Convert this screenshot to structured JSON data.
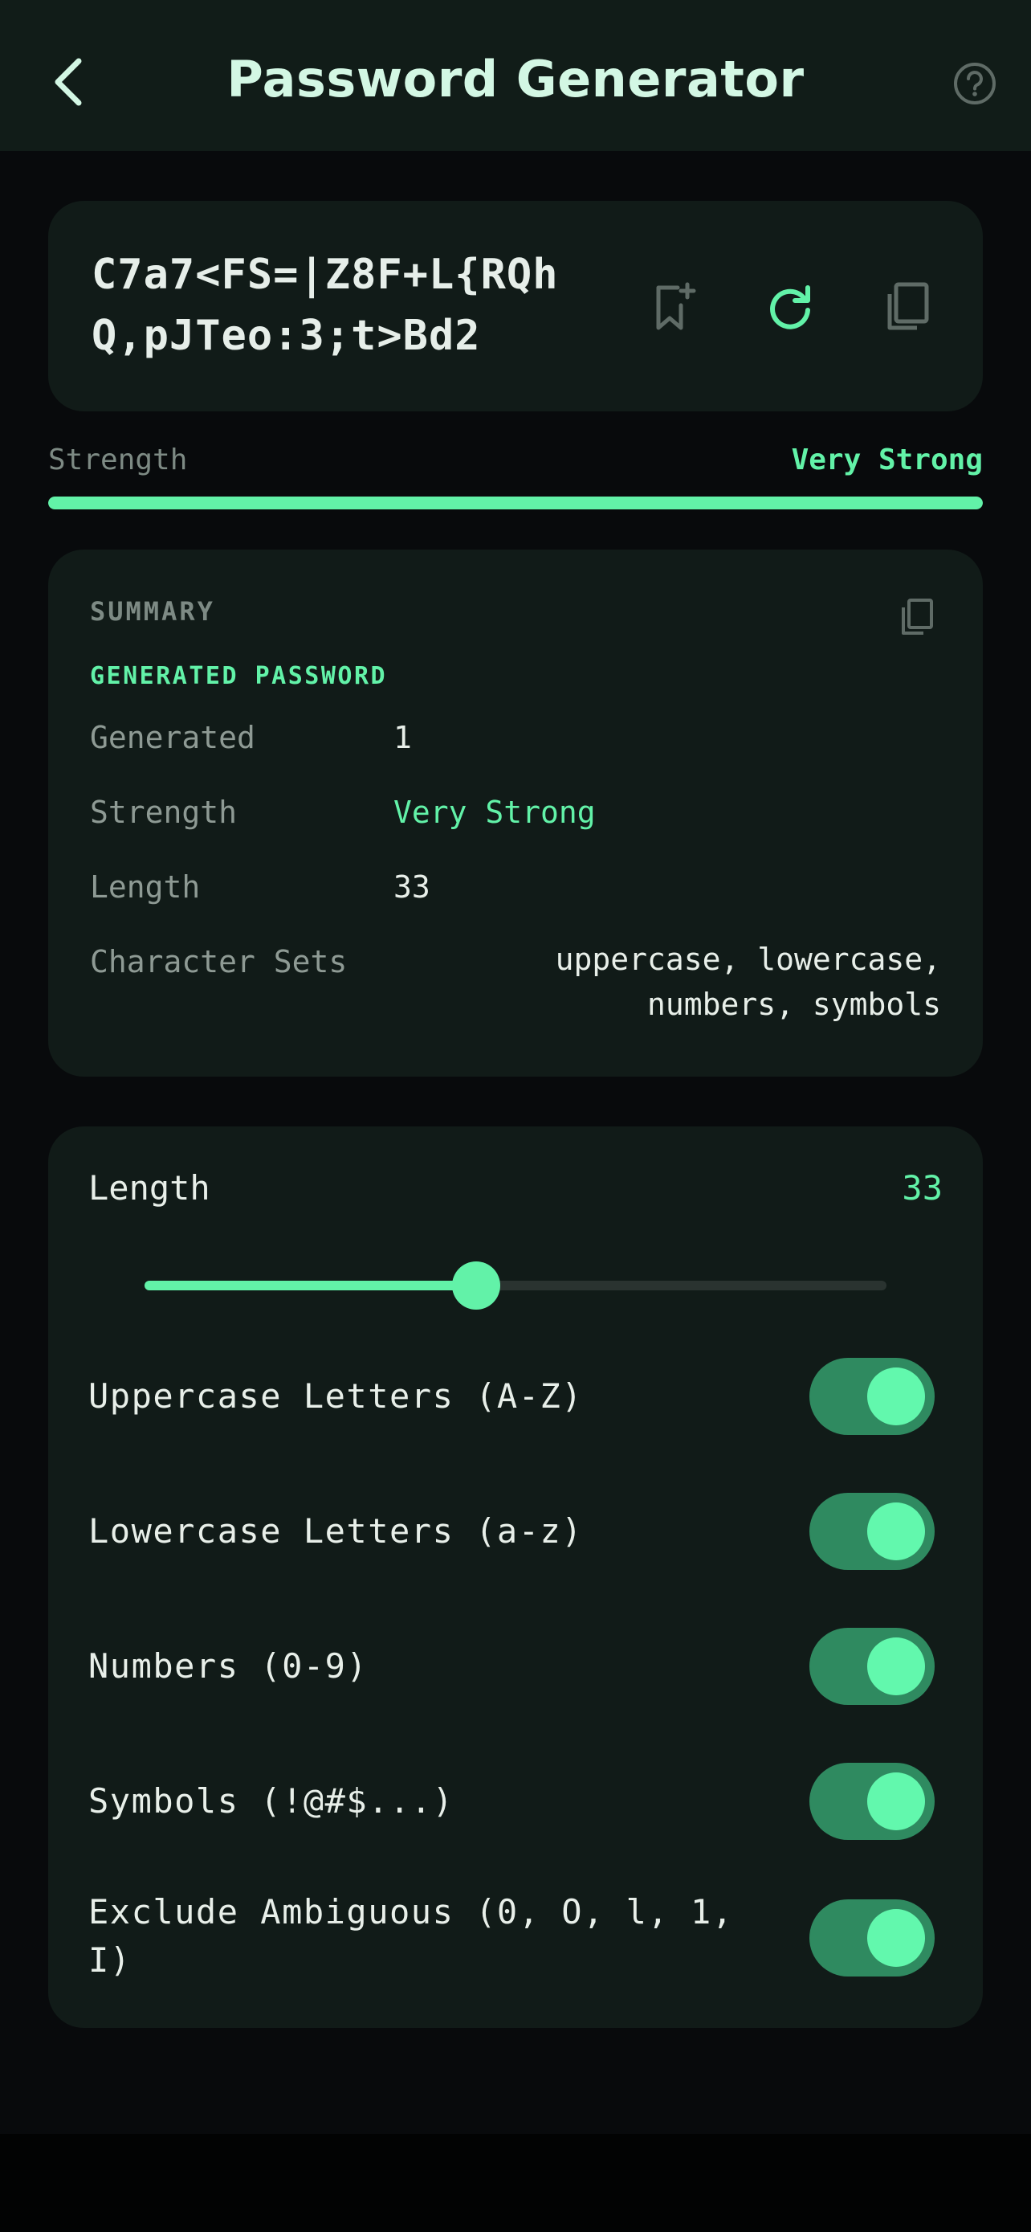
{
  "header": {
    "title": "Password Generator",
    "back_icon": "chevron-left-icon",
    "help_icon": "help-circle-icon"
  },
  "password": {
    "value": "C7a7<FS=|Z8F+L{RQhQ,pJTeo:3;t>Bd2",
    "actions": [
      "bookmark-add-icon",
      "refresh-icon",
      "copy-icon"
    ]
  },
  "strength": {
    "label": "Strength",
    "value": "Very Strong",
    "level": 1.0
  },
  "summary": {
    "heading": "SUMMARY",
    "section_label": "GENERATED PASSWORD",
    "rows": [
      {
        "label": "Generated",
        "value": "1"
      },
      {
        "label": "Strength",
        "value": "Very Strong"
      },
      {
        "label": "Length",
        "value": "33"
      },
      {
        "label": "Character Sets",
        "value": "uppercase, lowercase, numbers, symbols"
      }
    ]
  },
  "settings": {
    "length_label": "Length",
    "length_value": "33",
    "slider_fraction": 0.447,
    "options": [
      {
        "label": "Uppercase Letters (A-Z)",
        "enabled": true
      },
      {
        "label": "Lowercase Letters (a-z)",
        "enabled": true
      },
      {
        "label": "Numbers (0-9)",
        "enabled": true
      },
      {
        "label": "Symbols (!@#$...)",
        "enabled": true
      },
      {
        "label": "Exclude Ambiguous (0, O, l, 1, I)",
        "enabled": true
      }
    ]
  },
  "colors": {
    "accent": "#62f2a8",
    "toggle_on": "#2f8a60",
    "card": "#111b18",
    "background": "#080a0c"
  }
}
